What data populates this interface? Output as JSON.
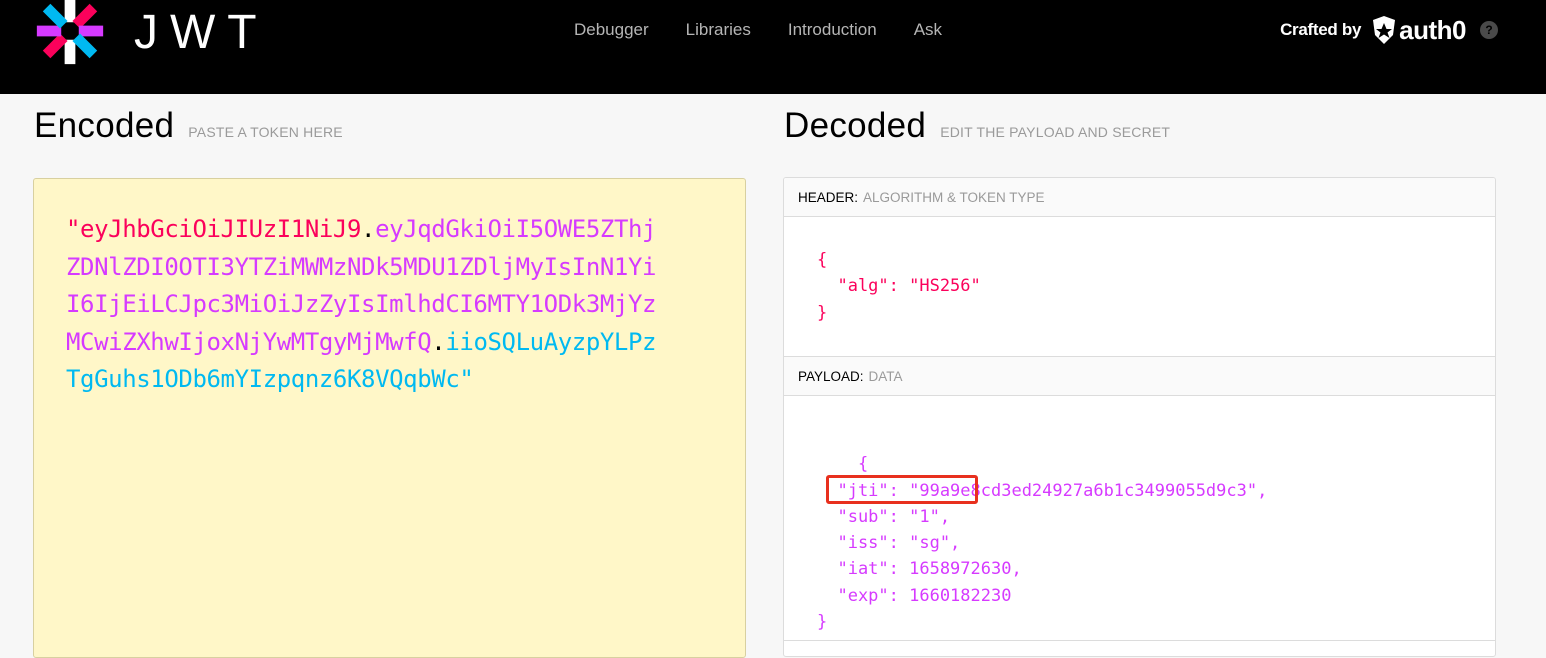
{
  "brand": {
    "wordmark": "JWT"
  },
  "nav": {
    "links": [
      "Debugger",
      "Libraries",
      "Introduction",
      "Ask"
    ],
    "crafted_by": "Crafted by",
    "auth0": "auth0",
    "help": "?"
  },
  "encoded": {
    "title": "Encoded",
    "subtitle": "PASTE A TOKEN HERE",
    "token_header": "\"eyJhbGciOiJIUzI1NiJ9",
    "token_payload": "eyJqdGkiOiI5OWE5ZThjZDNlZDI0OTI3YTZiMWMzNDk5MDU1ZDljMyIsInN1YiI6IjEiLCJpc3MiOiJzZyIsImlhdCI6MTY1ODk3MjYzMCwiZXhwIjoxNjYwMTgyMjMwfQ",
    "token_signature": "iioSQLuAyzpYLPzTgGuhs1ODb6mYIzpqnz6K8VQqbWc\"",
    "dot": "."
  },
  "decoded": {
    "title": "Decoded",
    "subtitle": "EDIT THE PAYLOAD AND SECRET",
    "header_label": "HEADER:",
    "header_desc": "ALGORITHM & TOKEN TYPE",
    "header_json": "{\n  \"alg\": \"HS256\"\n}",
    "payload_label": "PAYLOAD:",
    "payload_desc": "DATA",
    "payload_json": "{\n  \"jti\": \"99a9e8cd3ed24927a6b1c3499055d9c3\",\n  \"sub\": \"1\",\n  \"iss\": \"sg\",\n  \"iat\": 1658972630,\n  \"exp\": 1660182230\n}"
  },
  "colors": {
    "header": "#fb015b",
    "payload": "#d63aff",
    "signature": "#00b9f1",
    "highlight": "#e8301e"
  }
}
